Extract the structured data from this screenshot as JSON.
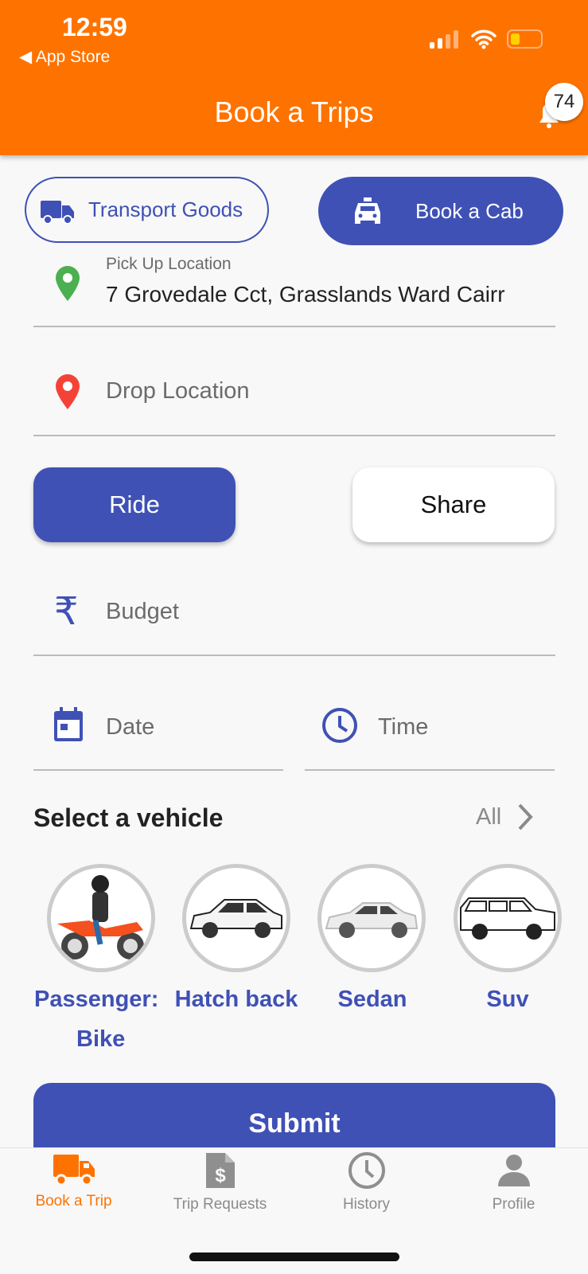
{
  "status_bar": {
    "time": "12:59",
    "back_label": "App Store"
  },
  "header": {
    "title": "Book a Trips",
    "notification_count": "74"
  },
  "mode_buttons": {
    "transport_goods": "Transport Goods",
    "book_cab": "Book a Cab",
    "selected": "Book a Cab"
  },
  "pickup": {
    "label": "Pick Up Location",
    "value": "7 Grovedale Cct, Grasslands Ward Cairr"
  },
  "drop": {
    "placeholder": "Drop Location"
  },
  "ride_type": {
    "ride": "Ride",
    "share": "Share",
    "selected": "Ride"
  },
  "budget": {
    "placeholder": "Budget"
  },
  "date": {
    "placeholder": "Date"
  },
  "time": {
    "placeholder": "Time"
  },
  "vehicles": {
    "title": "Select a vehicle",
    "all_label": "All",
    "items": [
      {
        "label": "Passenger: Bike",
        "line1": "Passenger:",
        "line2": "Bike"
      },
      {
        "label": "Hatch back"
      },
      {
        "label": "Sedan"
      },
      {
        "label": "Suv"
      }
    ]
  },
  "submit_label": "Submit",
  "tabs": [
    {
      "label": "Book a Trip",
      "icon": "truck-icon",
      "active": true
    },
    {
      "label": "Trip Requests",
      "icon": "invoice-icon"
    },
    {
      "label": "History",
      "icon": "clock-icon"
    },
    {
      "label": "Profile",
      "icon": "person-icon"
    }
  ],
  "colors": {
    "header": "#fe7300",
    "primary": "#3f51b5",
    "active_tab": "#fe7300"
  }
}
